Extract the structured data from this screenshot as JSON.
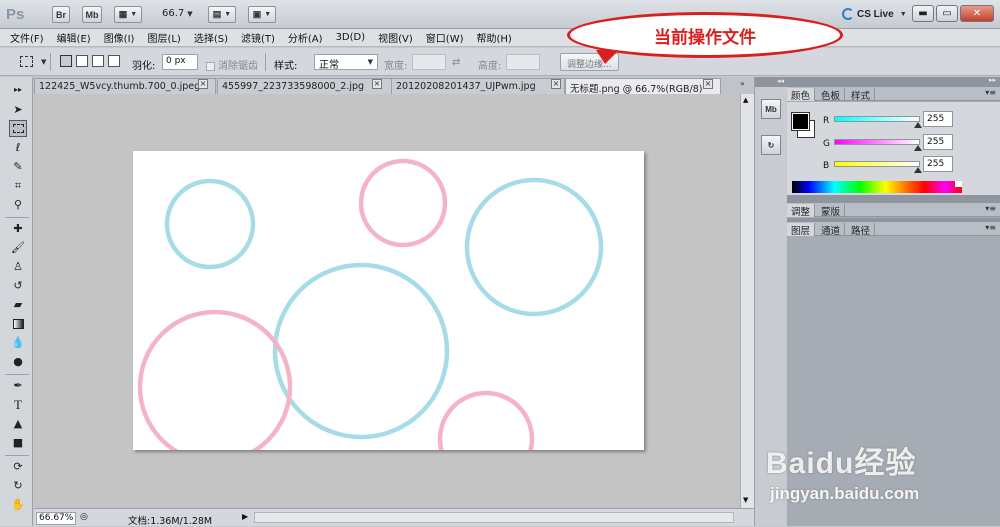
{
  "title_bar": {
    "app_logo": "Ps",
    "bridge_label": "Br",
    "mini_bridge_label": "Mb",
    "zoom_value": "66.7",
    "cs_live_label": "CS Live"
  },
  "menu": {
    "items": [
      "文件(F)",
      "编辑(E)",
      "图像(I)",
      "图层(L)",
      "选择(S)",
      "滤镜(T)",
      "分析(A)",
      "3D(D)",
      "视图(V)",
      "窗口(W)",
      "帮助(H)"
    ]
  },
  "options_bar": {
    "feather_label": "羽化:",
    "feather_value": "0 px",
    "antialias_label": "消除锯齿",
    "style_label": "样式:",
    "style_value": "正常",
    "width_label": "宽度:",
    "height_label": "高度:",
    "refine_edge_label": "调整边缘..."
  },
  "callout": {
    "text": "当前操作文件",
    "color": "#d8201e"
  },
  "tabs": [
    {
      "label": "122425_W5vcy.thumb.700_0.jpeg",
      "active": false
    },
    {
      "label": "455997_223733598000_2.jpg",
      "active": false
    },
    {
      "label": "20120208201437_UJPwm.jpg",
      "active": false
    },
    {
      "label": "无标题.png @ 66.7%(RGB/8)",
      "active": true
    }
  ],
  "status": {
    "zoom": "66.67%",
    "doc_info": "文档:1.36M/1.28M"
  },
  "canvas": {
    "circle_colors": {
      "blue": "#a6dbe8",
      "pink": "#f5b3c8"
    }
  },
  "panels": {
    "color_tabs": [
      "颜色",
      "色板",
      "样式"
    ],
    "r_label": "R",
    "g_label": "G",
    "b_label": "B",
    "r_value": "255",
    "g_value": "255",
    "b_value": "255",
    "adjust_tabs": [
      "调整",
      "蒙版"
    ],
    "layer_tabs": [
      "图层",
      "通道",
      "路径"
    ]
  },
  "watermark": {
    "brand": "Baidu经验",
    "url": "jingyan.baidu.com"
  }
}
